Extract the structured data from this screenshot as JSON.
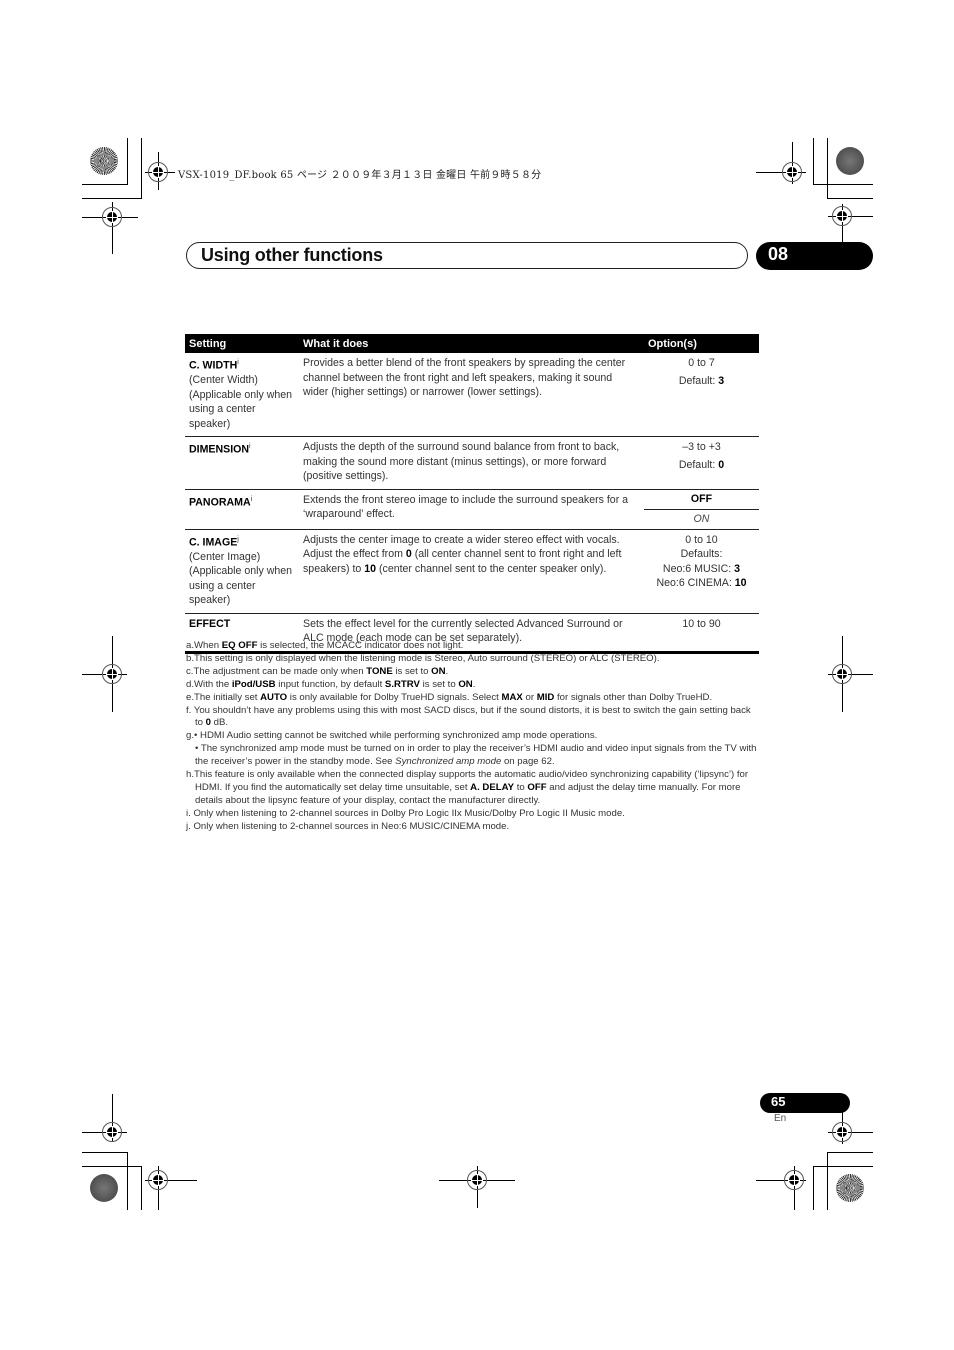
{
  "print_header": "VSX-1019_DF.book  65 ページ  ２００９年３月１３日  金曜日  午前９時５８分",
  "header": {
    "section_title": "Using other functions",
    "chapter_number": "08"
  },
  "table": {
    "columns": [
      "Setting",
      "What it does",
      "Option(s)"
    ],
    "rows": [
      {
        "setting": "C. WIDTH",
        "footnote_ref": "i",
        "setting_note": "(Center Width) (Applicable only when using a center speaker)",
        "description": "Provides a better blend of the front speakers by spreading the center channel between the front right and left speakers, making it sound wider (higher settings) or narrower (lower settings).",
        "range": "0 to 7",
        "default_label": "Default: ",
        "default_value": "3"
      },
      {
        "setting": "DIMENSION",
        "footnote_ref": "i",
        "description": "Adjusts the depth of the surround sound balance from front to back, making the sound more distant (minus settings), or more forward (positive settings).",
        "range": "–3 to +3",
        "default_label": "Default: ",
        "default_value": "0"
      },
      {
        "setting": "PANORAMA",
        "footnote_ref": "i",
        "description": "Extends the front stereo image to include the surround speakers for a ‘wraparound’ effect.",
        "options": [
          "OFF",
          "ON"
        ]
      },
      {
        "setting": "C. IMAGE",
        "footnote_ref": "j",
        "setting_note": "(Center Image) (Applicable only when using a center speaker)",
        "description_parts": [
          "Adjusts the center image to create a wider stereo effect with vocals. Adjust the effect from ",
          "0",
          " (all center channel sent to front right and left speakers) to ",
          "10",
          " (center channel sent to the center speaker only)."
        ],
        "range": "0 to 10",
        "defaults_label": "Defaults:",
        "defaults": [
          {
            "label": "Neo:6 MUSIC: ",
            "value": "3"
          },
          {
            "label": "Neo:6 CINEMA: ",
            "value": "10"
          }
        ]
      },
      {
        "setting": "EFFECT",
        "description": "Sets the effect level for the currently selected Advanced Surround or ALC mode (each mode can be set separately).",
        "range": "10 to 90"
      }
    ]
  },
  "footnotes": {
    "a": [
      "a.When ",
      "EQ OFF",
      " is selected, the MCACC indicator does not light."
    ],
    "b": "b.This setting is only displayed when the listening mode is Stereo, Auto surround (STEREO) or ALC (STEREO).",
    "c": [
      "c.The adjustment can be made only when ",
      "TONE",
      " is set to ",
      "ON",
      "."
    ],
    "d": [
      "d.With the ",
      "iPod/USB",
      " input function, by default ",
      "S.RTRV",
      " is set to ",
      "ON",
      "."
    ],
    "e": [
      "e.The initially set ",
      "AUTO",
      " is only available for Dolby TrueHD signals. Select ",
      "MAX",
      " or ",
      "MID",
      " for signals other than Dolby TrueHD."
    ],
    "f": [
      "f. You shouldn’t have any problems using this with most SACD discs, but if the sound distorts, it is best to switch the gain setting back to ",
      "0",
      " dB."
    ],
    "g1": "g.• HDMI Audio setting cannot be switched while performing synchronized amp mode operations.",
    "g2": [
      "• The synchronized amp mode must be turned on in order to play the receiver’s HDMI audio and video input signals from the TV with the receiver’s power in the standby mode. See ",
      "Synchronized amp mode",
      " on page 62."
    ],
    "h": [
      "h.This feature is only available when the connected display supports the automatic audio/video synchronizing capability (‘lipsync’) for HDMI. If you find the automatically set delay time unsuitable, set ",
      "A. DELAY",
      " to ",
      "OFF",
      " and adjust the delay time manually. For more details about the lipsync feature of your display, contact the manufacturer directly."
    ],
    "i": "i. Only when listening to 2-channel sources in Dolby Pro Logic IIx Music/Dolby Pro Logic II Music mode.",
    "j": "j. Only when listening to 2-channel sources in Neo:6 MUSIC/CINEMA mode."
  },
  "footer": {
    "page_number": "65",
    "language": "En"
  }
}
